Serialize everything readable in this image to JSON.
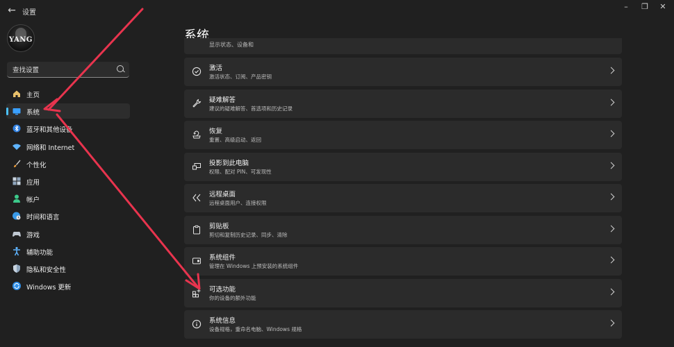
{
  "window": {
    "title": "设置"
  },
  "search": {
    "placeholder": "查找设置"
  },
  "avatar": {
    "text": "YANG"
  },
  "nav": [
    {
      "label": "主页",
      "icon": "home-icon"
    },
    {
      "label": "系统",
      "icon": "monitor-icon",
      "active": true
    },
    {
      "label": "蓝牙和其他设备",
      "icon": "bluetooth-icon"
    },
    {
      "label": "网络和 Internet",
      "icon": "wifi-icon"
    },
    {
      "label": "个性化",
      "icon": "brush-icon"
    },
    {
      "label": "应用",
      "icon": "apps-icon"
    },
    {
      "label": "帐户",
      "icon": "person-icon"
    },
    {
      "label": "时间和语言",
      "icon": "globe-clock-icon"
    },
    {
      "label": "游戏",
      "icon": "gamepad-icon"
    },
    {
      "label": "辅助功能",
      "icon": "accessibility-icon"
    },
    {
      "label": "隐私和安全性",
      "icon": "shield-icon"
    },
    {
      "label": "Windows 更新",
      "icon": "windows-update-icon"
    }
  ],
  "main": {
    "title": "系统",
    "partial_desc": "显示状态、设备和",
    "cards": [
      {
        "title": "激活",
        "desc": "激活状态、订阅、产品密钥",
        "icon": "check-circle-icon"
      },
      {
        "title": "疑难解答",
        "desc": "建议的疑难解答、首选项和历史记录",
        "icon": "wrench-icon"
      },
      {
        "title": "恢复",
        "desc": "重置、高级启动、返回",
        "icon": "recovery-icon"
      },
      {
        "title": "投影到此电脑",
        "desc": "权限、配对 PIN、可发现性",
        "icon": "projection-icon"
      },
      {
        "title": "远程桌面",
        "desc": "远程桌面用户、连接权限",
        "icon": "remote-desktop-icon"
      },
      {
        "title": "剪贴板",
        "desc": "剪切和复制历史记录、同步、清除",
        "icon": "clipboard-icon"
      },
      {
        "title": "系统组件",
        "desc": "管理在 Windows 上预安装的系统组件",
        "icon": "components-icon"
      },
      {
        "title": "可选功能",
        "desc": "你的设备的额外功能",
        "icon": "optional-features-icon"
      },
      {
        "title": "系统信息",
        "desc": "设备规格，重命名电脑、Windows 规格",
        "icon": "info-icon"
      }
    ]
  },
  "colors": {
    "background": "#202020",
    "card": "#2b2b2b",
    "accent": "#4cc2ff",
    "annotation_arrow": "#e8344e"
  }
}
